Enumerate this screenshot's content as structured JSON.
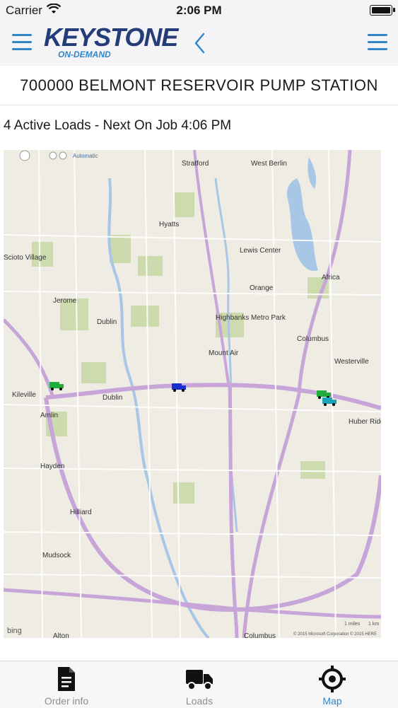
{
  "status_bar": {
    "carrier": "Carrier",
    "time": "2:06 PM"
  },
  "header": {
    "logo_title": "KEYSTONE",
    "logo_subtitle": "ON-DEMAND",
    "left_icon": "menu-icon",
    "back_icon": "chevron-left-icon",
    "right_icon": "menu-icon"
  },
  "page": {
    "title": "700000 BELMONT RESERVOIR PUMP STATION",
    "subtitle": "4 Active Loads - Next On Job 4:06 PM"
  },
  "map": {
    "view_mode": "Automatic",
    "places": [
      "Stratford",
      "West Berlin",
      "Hyatts",
      "Lewis Center",
      "Scioto Village",
      "Orange",
      "Africa",
      "Jerome",
      "Dublin",
      "Highbanks Metro Park",
      "Columbus",
      "Mount Air",
      "Westerville",
      "Kileville",
      "Dublin",
      "Amlin",
      "Huber Ridge",
      "Hayden",
      "Hilliard",
      "Mudsock",
      "Alton",
      "Columbus"
    ],
    "scale_miles": "1 miles",
    "scale_km": "1 km",
    "copyright": "© 2015 Microsoft Corporation  © 2015 HERE",
    "branding": "bing",
    "truck_colors": [
      "#1fae3a",
      "#1c2fd1",
      "#1fae3a",
      "#1aa3b8"
    ]
  },
  "tabs": [
    {
      "label": "Order info",
      "icon": "document-icon",
      "active": false
    },
    {
      "label": "Loads",
      "icon": "truck-icon",
      "active": false
    },
    {
      "label": "Map",
      "icon": "target-icon",
      "active": true
    }
  ],
  "colors": {
    "accent": "#2f86c9",
    "brand_dark": "#243d78",
    "map_bg": "#efece4"
  }
}
